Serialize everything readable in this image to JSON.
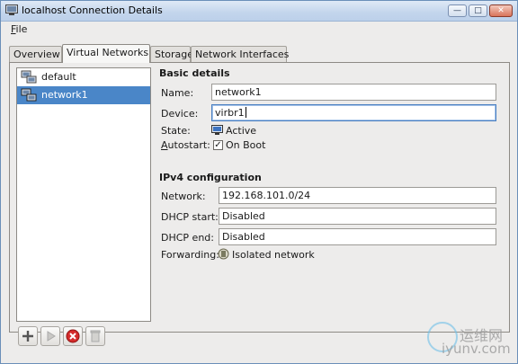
{
  "window": {
    "title": "localhost Connection Details",
    "controls": [
      "minimize",
      "maximize",
      "close"
    ]
  },
  "menubar": {
    "file": "File",
    "file_mnemonic": "F"
  },
  "tabs": [
    "Overview",
    "Virtual Networks",
    "Storage",
    "Network Interfaces"
  ],
  "active_tab": "Virtual Networks",
  "networks": [
    {
      "label": "default",
      "icon": "network-icon",
      "selected": false
    },
    {
      "label": "network1",
      "icon": "network-icon",
      "selected": true
    }
  ],
  "basic": {
    "heading": "Basic details",
    "name_label": "Name:",
    "name_value": "network1",
    "device_label": "Device:",
    "device_value": "virbr1",
    "state_label": "State:",
    "state_value": "Active",
    "autostart_label": "Autostart:",
    "autostart_value": "On Boot",
    "autostart_checked": true
  },
  "ipv4": {
    "heading": "IPv4 configuration",
    "network_label": "Network:",
    "network_value": "192.168.101.0/24",
    "dhcp_start_label": "DHCP start:",
    "dhcp_start_value": "Disabled",
    "dhcp_end_label": "DHCP end:",
    "dhcp_end_value": "Disabled",
    "forwarding_label": "Forwarding:",
    "forwarding_value": "Isolated network"
  },
  "toolbar_buttons": [
    "add-icon",
    "start-icon",
    "stop-icon",
    "delete-icon"
  ],
  "watermark": {
    "cn": "运维网",
    "site": "iyunv.com"
  },
  "colors": {
    "selection": "#4a86c8",
    "titlebar": "#c3d5ec",
    "stop_red": "#d42b2b"
  }
}
